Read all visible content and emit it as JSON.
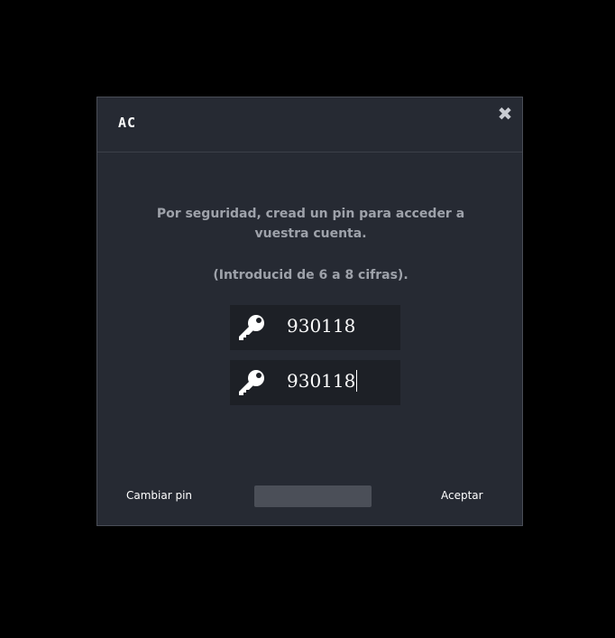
{
  "window": {
    "logo": "AC",
    "close_icon": "close-icon"
  },
  "content": {
    "message": "Por seguridad, cread un pin para acceder a vuestra cuenta.",
    "hint": "(Introducid de 6 a 8 cifras)."
  },
  "pins": [
    {
      "icon": "key-icon",
      "value": "930118"
    },
    {
      "icon": "key-icon",
      "value": "930118"
    }
  ],
  "buttons": {
    "change_pin": "Cambiar pin",
    "middle": "",
    "accept": "Aceptar"
  },
  "colors": {
    "dialog_bg": "#262a33",
    "input_bg": "#1d2026",
    "muted_text": "#9ea2aa",
    "middle_button": "#4b4f58"
  }
}
